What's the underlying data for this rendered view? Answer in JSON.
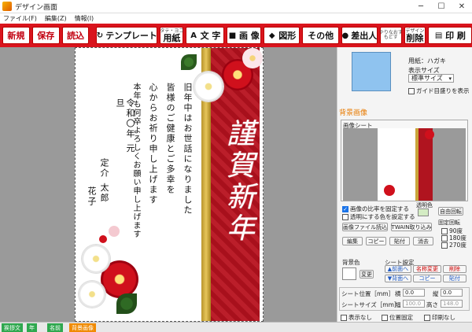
{
  "window": {
    "title": "デザイン画面"
  },
  "menu": [
    "ファイル(F)",
    "編集(Z)",
    "情報(I)"
  ],
  "toolbar": {
    "new": "新規",
    "save": "保存",
    "load": "読込",
    "template": "テンプレート",
    "paper_small": "タテ・ヨコ",
    "paper": "用紙",
    "text": "文 字",
    "image": "画 像",
    "shape": "図形",
    "other": "その他",
    "sender": "差出人",
    "undo_small": "やりなおす",
    "redo_small": "もどす",
    "delete_small": "デザイン",
    "delete": "削除",
    "print": "印 刷"
  },
  "card": {
    "brush": "謹賀新年",
    "greeting_lines": [
      "旧年中はお世話になりました",
      "皆様のご健康とご多幸を",
      "心からお祈り申し上げます",
      "本年も何卒よろしくお願い申し上げます",
      "令和〇年 元旦"
    ],
    "sender_lines": [
      "定介 太郎",
      "花子"
    ]
  },
  "panel": {
    "paper_label": "用紙：ハガキ",
    "display_size_label": "表示サイズ",
    "display_size_value": "標準サイズ",
    "guide_check": "ガイド目盛りを表示",
    "section_title": "背景画像",
    "sheet_label": "画像シート",
    "fix_ratio": "画像の比率を固定する",
    "transparent_set": "透明にする色を設定する",
    "transparent_color_label": "透明色",
    "free_rotate": "自由回転",
    "fixed_rotate": "固定回転",
    "rot90": "90度",
    "rot180": "180度",
    "rot270": "270度",
    "load_image": "画像ファイル読込",
    "twain": "TWAIN取り込み",
    "edit": "編集",
    "copy": "コピー",
    "paste": "貼付",
    "erase": "消去",
    "bg_color_label": "背景色",
    "change": "変更",
    "sheet_settings": "シート設定",
    "front": "▲前面へ",
    "back": "▼背面へ",
    "rename": "名称変更",
    "copy2": "コピー",
    "del": "削除",
    "paste2": "貼付",
    "pos_label": "シート位置［mm］",
    "x_label": "横",
    "x_val": "0.0",
    "y_label": "縦",
    "y_val": "0.0",
    "size_label": "シートサイズ［mm］",
    "w_label": "幅",
    "w_val": "100.0",
    "h_label": "高さ",
    "h_val": "148.0",
    "hide": "表示なし",
    "lock_pos": "位置固定",
    "no_print": "印刷なし"
  },
  "status_tabs": [
    "挨拶文",
    "年",
    "名前",
    "背景画像"
  ],
  "colors": {
    "brand": "#d9141d",
    "gold": "#c9a53a",
    "tab_green": "#2fa84f",
    "tab_orange": "#f08a00"
  }
}
